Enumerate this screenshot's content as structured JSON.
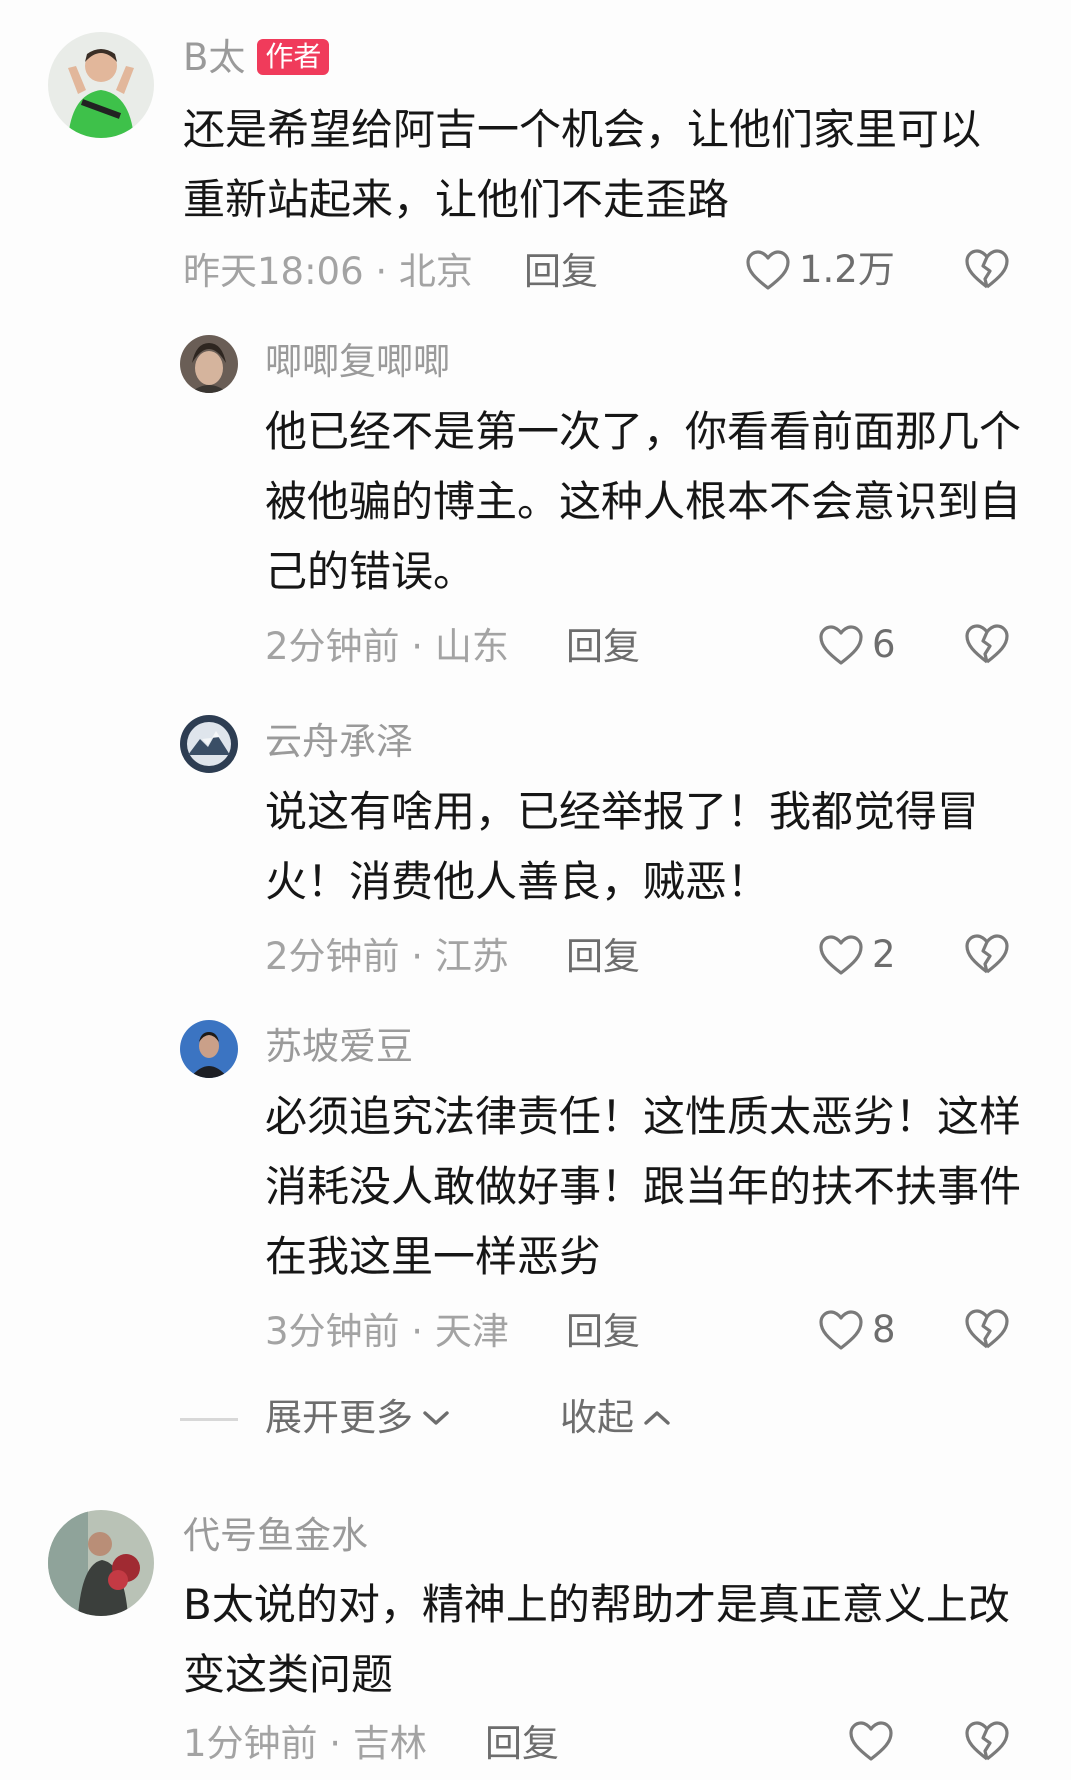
{
  "comments": [
    {
      "user": "B太",
      "badge": "作者",
      "text": "还是希望给阿吉一个机会，让他们家里可以重新站起来，让他们不走歪路",
      "meta": "昨天18:06 · 北京",
      "reply": "回复",
      "likes": "1.2万",
      "avatar_icon": "user-avatar-green-shirt"
    },
    {
      "user": "唧唧复唧唧",
      "text": "他已经不是第一次了，你看看前面那几个被他骗的博主。这种人根本不会意识到自己的错误。",
      "meta": "2分钟前 · 山东",
      "reply": "回复",
      "likes": "6",
      "avatar_icon": "user-avatar-anime"
    },
    {
      "user": "云舟承泽",
      "text": "说这有啥用，已经举报了！我都觉得冒火！消费他人善良，贼恶！",
      "meta": "2分钟前 · 江苏",
      "reply": "回复",
      "likes": "2",
      "avatar_icon": "user-avatar-mountain"
    },
    {
      "user": "苏坡爱豆",
      "text": "必须追究法律责任！这性质太恶劣！这样消耗没人敢做好事！跟当年的扶不扶事件在我这里一样恶劣",
      "meta": "3分钟前 · 天津",
      "reply": "回复",
      "likes": "8",
      "avatar_icon": "user-avatar-portrait"
    },
    {
      "user": "代号鱼金水",
      "text": "B太说的对，精神上的帮助才是真正意义上改变这类问题",
      "meta": "1分钟前 · 吉林",
      "reply": "回复",
      "likes": "",
      "avatar_icon": "user-avatar-flowers"
    }
  ],
  "thread": {
    "expand_label": "展开更多",
    "collapse_label": "收起"
  },
  "colors": {
    "badge": "#f03b5b",
    "text": "#161616",
    "muted": "#a3a3a3"
  }
}
